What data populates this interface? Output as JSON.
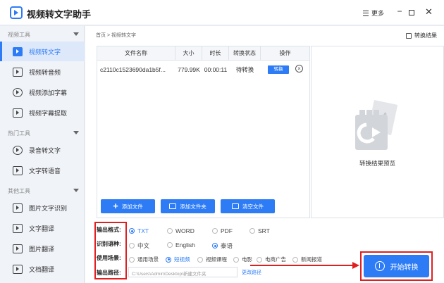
{
  "app": {
    "title": "视频转文字助手",
    "more_label": "更多",
    "min_label": "−",
    "close_label": "✕"
  },
  "sidebar": {
    "sections": [
      {
        "title": "视频工具",
        "items": [
          "视频转文字",
          "视频转音频",
          "视频添加字幕",
          "视频字幕提取"
        ]
      },
      {
        "title": "热门工具",
        "items": [
          "录音转文字",
          "文字转语音"
        ]
      },
      {
        "title": "其他工具",
        "items": [
          "图片文字识别",
          "文字翻译",
          "图片翻译",
          "文档翻译"
        ]
      }
    ]
  },
  "main": {
    "breadcrumb": "首页 > 视频转文字",
    "result_link": "转换结果",
    "table": {
      "headers": [
        "文件名称",
        "大小",
        "时长",
        "转换状态",
        "操作"
      ],
      "rows": [
        {
          "name": "c2110c1523690da1b5f...",
          "size": "779.99K",
          "duration": "00:00:11",
          "status": "待转换",
          "action": "转换"
        }
      ]
    },
    "preview_label": "转换结果预览",
    "buttons": {
      "add_file": "添加文件",
      "add_folder": "添加文件夹",
      "clear_files": "清空文件"
    },
    "options": {
      "format_label": "输出格式:",
      "formats": [
        "TXT",
        "WORD",
        "PDF",
        "SRT"
      ],
      "format_selected": "TXT",
      "lang_label": "识别语种:",
      "langs": [
        "中文",
        "English",
        "泰语"
      ],
      "lang_selected": "泰语",
      "scene_label": "使用场景:",
      "scenes": [
        "通用场景",
        "短视频",
        "视频课程",
        "电影",
        "电商广告",
        "新闻报道"
      ],
      "scene_selected": "短视频",
      "path_label": "输出路径:",
      "path_value": "C:\\Users\\Admin\\Desktop\\新建文件夹",
      "change_path": "更改路径"
    },
    "start_button": "开始转换"
  },
  "colors": {
    "accent": "#2d7cf6",
    "annotation": "#e02020"
  }
}
